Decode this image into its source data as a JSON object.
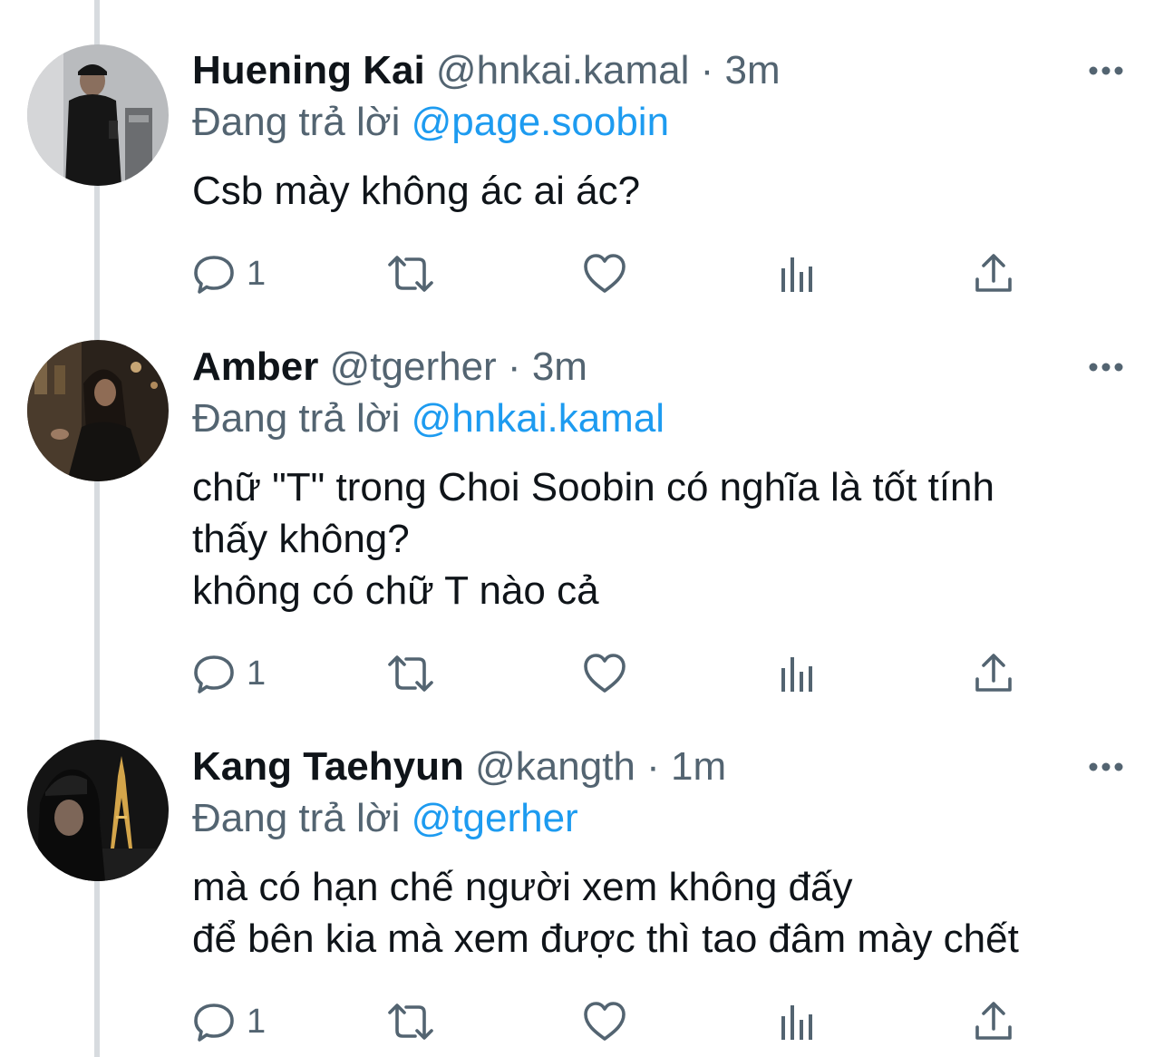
{
  "tweets": [
    {
      "name": "Huening Kai",
      "handle": "@hnkai.kamal",
      "separator": "·",
      "time": "3m",
      "replying_label": "Đang trả lời",
      "replying_to": "@page.soobin",
      "lines": [
        "Csb mày không ác ai ác?"
      ],
      "reply_count": "1",
      "avatar": "person-photo-mirror-selfie"
    },
    {
      "name": "Amber",
      "handle": "@tgerher",
      "separator": "·",
      "time": "3m",
      "replying_label": "Đang trả lời",
      "replying_to": "@hnkai.kamal",
      "lines": [
        "chữ \"T\" trong Choi Soobin có nghĩa là tốt tính",
        "thấy không?",
        "không có chữ T nào cả"
      ],
      "reply_count": "1",
      "avatar": "person-photo-night-street"
    },
    {
      "name": "Kang Taehyun",
      "handle": "@kangth",
      "separator": "·",
      "time": "1m",
      "replying_label": "Đang trả lời",
      "replying_to": "@tgerher",
      "lines": [
        "mà có hạn chế người xem không đấy",
        "để bên kia mà xem được thì tao đâm mày chết"
      ],
      "reply_count": "1",
      "avatar": "person-photo-eiffel-tower"
    }
  ],
  "icons": {
    "reply": "reply-icon",
    "retweet": "retweet-icon",
    "like": "heart-icon",
    "views": "views-icon",
    "share": "share-icon",
    "more": "more-icon"
  },
  "colors": {
    "text": "#0f1419",
    "secondary": "#536471",
    "mention": "#1d9bf0",
    "thread_line": "#d7dbdf"
  }
}
